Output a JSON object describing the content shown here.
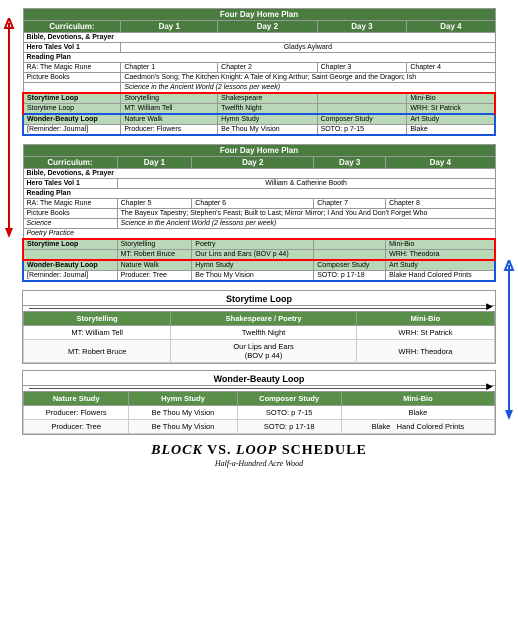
{
  "page": {
    "title": "Block vs. Loop Schedule",
    "subtitle": "Half-a-Hundred Acre Wood"
  },
  "table1": {
    "header": "Four Day Home Plan",
    "cols": [
      "Curriculum:",
      "Day 1",
      "Day 2",
      "Day 3",
      "Day 4"
    ],
    "rows": [
      {
        "type": "label",
        "cells": [
          "Bible, Devotions, & Prayer",
          "",
          "",
          "",
          ""
        ]
      },
      {
        "type": "person",
        "cells": [
          "Hero Tales Vol 1",
          "",
          "Gladys Aylward",
          "",
          ""
        ]
      },
      {
        "type": "label",
        "cells": [
          "Reading Plan",
          "",
          "",
          "",
          ""
        ]
      },
      {
        "type": "data",
        "cells": [
          "RA: The Magic Rune",
          "Chapter 1",
          "Chapter 2",
          "Chapter 3",
          "Chapter 4"
        ]
      },
      {
        "type": "data",
        "cells": [
          "Picture Books",
          "Caedmon's Song; The Kitchen Knight: A Tale of King Arthur; Saint George and the Dragon; Ish",
          "",
          "",
          ""
        ]
      },
      {
        "type": "italic",
        "cells": [
          "",
          "Science in the Ancient World (2 lessons per week)",
          "",
          "",
          ""
        ]
      },
      {
        "type": "storytime-highlight",
        "cells": [
          "Storytime Loop",
          "Storytelling",
          "Shakespeare",
          "",
          "Mini-Bio"
        ]
      },
      {
        "type": "storytime-sub",
        "cells": [
          "Storytime Loop",
          "MT: William Tell",
          "Twelfth Night",
          "",
          "WRH: St Patrick"
        ]
      },
      {
        "type": "wonder-highlight",
        "cells": [
          "Wonder-Beauty Loop",
          "Nature Walk",
          "Hymn Study",
          "Composer Study",
          "Art Study"
        ]
      },
      {
        "type": "reminder",
        "cells": [
          "[Reminder: Journal]",
          "Producer: Flowers",
          "Be Thou My Vision",
          "SOTO: p 7-15",
          "Blake"
        ]
      }
    ]
  },
  "table2": {
    "header": "Four Day Home Plan",
    "cols": [
      "Curriculum:",
      "Day 1",
      "Day 2",
      "Day 3",
      "Day 4"
    ],
    "rows": [
      {
        "type": "label",
        "cells": [
          "Bible, Devotions, & Prayer",
          "",
          "",
          "",
          ""
        ]
      },
      {
        "type": "person",
        "cells": [
          "Hero Tales Vol 1",
          "",
          "William & Catherine Booth",
          "",
          ""
        ]
      },
      {
        "type": "label",
        "cells": [
          "Reading Plan",
          "",
          "",
          "",
          ""
        ]
      },
      {
        "type": "data",
        "cells": [
          "RA: The Magic Rune",
          "Chapter 5",
          "Chapter 6",
          "Chapter 7",
          "Chapter 8"
        ]
      },
      {
        "type": "data",
        "cells": [
          "Picture Books",
          "The Bayeux Tapestry; Stephen's Feast; Built to Last; Mirror Mirror; I And You And Don't Forget Who",
          "",
          "",
          ""
        ]
      },
      {
        "type": "italic",
        "cells": [
          "Science",
          "Science in the Ancient World (2 lessons per week)",
          "",
          "",
          ""
        ]
      },
      {
        "type": "italic",
        "cells": [
          "Poetry Practice",
          "",
          "",
          "",
          ""
        ]
      },
      {
        "type": "storytime-highlight",
        "cells": [
          "Storytime Loop",
          "Storytelling",
          "Poetry",
          "",
          "Mini-Bio"
        ]
      },
      {
        "type": "storytime-sub",
        "cells": [
          "",
          "MT: Robert Bruce",
          "Our Lins and Ears (BOV p 44)",
          "",
          "WRH: Theodora"
        ]
      },
      {
        "type": "wonder-highlight",
        "cells": [
          "Wonder-Beauty Loop",
          "Nature Walk",
          "Hymn Study",
          "Composer Study",
          "Art Study"
        ]
      },
      {
        "type": "reminder",
        "cells": [
          "[Reminder: Journal]",
          "Producer: Tree",
          "Be Thou My Vision",
          "SOTO: p 17-18",
          "Blake   Hand Colored Prints"
        ]
      }
    ]
  },
  "storytime_loop": {
    "title": "Storytime Loop",
    "cols": [
      "Storytelling",
      "Shakespeare / Poetry",
      "Mini-Bio"
    ],
    "rows": [
      [
        "MT: William Tell",
        "Twelfth Night",
        "WRH: St Patrick"
      ],
      [
        "MT: Robert Bruce",
        "Our Lips and Ears\n(BOV p 44)",
        "WRH: Theodora"
      ]
    ]
  },
  "wonder_loop": {
    "title": "Wonder-Beauty Loop",
    "cols": [
      "Nature Study",
      "Hymn Study",
      "Composer Study",
      "Mini-Bio"
    ],
    "rows": [
      [
        "Producer: Flowers",
        "Be Thou My Vision",
        "SOTO: p 7-15",
        "Blake"
      ],
      [
        "Producer: Tree",
        "Be Thou My Vision",
        "SOTO: p 17-18",
        "Blake   Hand Colored Prints"
      ]
    ]
  }
}
